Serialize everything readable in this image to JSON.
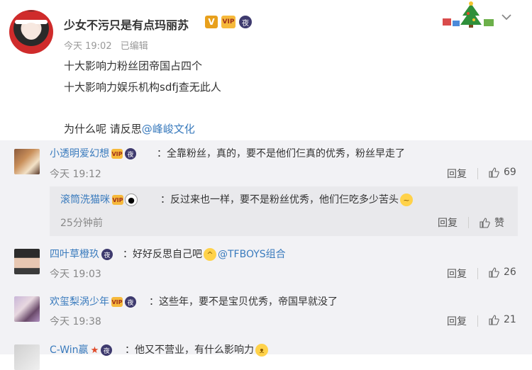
{
  "post": {
    "username": "少女不污只是有点玛丽苏",
    "badges": {
      "verified": "V",
      "vip": "VIP",
      "night": "夜"
    },
    "time": "今天 19:02",
    "edited": "已编辑",
    "lines": [
      "十大影响力粉丝团帝国占四个",
      "十大影响力娱乐机构sdfj查无此人",
      "为什么呢 请反思"
    ],
    "mention": "@峰峻文化",
    "deco_icon": "christmas-tree-icon",
    "menu_icon": "chevron-down-icon"
  },
  "comments": [
    {
      "name": "小透明爱幻想",
      "text": "：全靠粉丝，真的，要不是他们仨真的优秀，粉丝早走了",
      "time": "今天 19:12",
      "reply": "回复",
      "likes": "69",
      "nested": {
        "name": "滚筒洗猫咪",
        "text": "：反过来也一样，要不是粉丝优秀，他们仨吃多少苦头",
        "time": "25分钟前",
        "reply": "回复",
        "likes": "赞"
      }
    },
    {
      "name": "四叶草橙玖",
      "text": "：好好反思自己吧",
      "mention": "@TFBOYS组合",
      "time": "今天 19:03",
      "reply": "回复",
      "likes": "26"
    },
    {
      "name": "欢玺梨涡少年",
      "text": "：这些年，要不是宝贝优秀，帝国早就没了",
      "time": "今天 19:38",
      "reply": "回复",
      "likes": "21"
    },
    {
      "name": "C-Win嬴",
      "text": "：他又不营业，有什么影响力",
      "time": "",
      "reply": "",
      "likes": ""
    }
  ],
  "colors": {
    "link": "#3a7bbd",
    "comment_bg": "#f2f2f5",
    "nested_bg": "#e9e9ec"
  }
}
